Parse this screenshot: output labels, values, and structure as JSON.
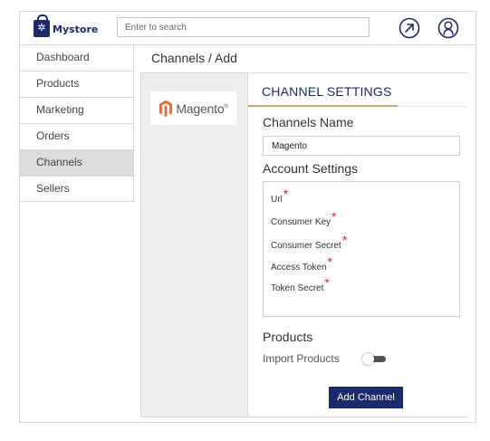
{
  "brand": {
    "name": "Mystore"
  },
  "search": {
    "placeholder": "Enter to search"
  },
  "header_icons": [
    "open-external-icon",
    "user-profile-icon"
  ],
  "sidebar": {
    "items": [
      {
        "label": "Dashboard",
        "active": false
      },
      {
        "label": "Products",
        "active": false
      },
      {
        "label": "Marketing",
        "active": false
      },
      {
        "label": "Orders",
        "active": false
      },
      {
        "label": "Channels",
        "active": true
      },
      {
        "label": "Sellers",
        "active": false
      }
    ]
  },
  "breadcrumb": "Channels / Add",
  "channel": {
    "name": "Magento"
  },
  "settings": {
    "title": "CHANNEL SETTINGS",
    "channels_name_label": "Channels Name",
    "channels_name_value": "Magento",
    "account_settings_label": "Account Settings",
    "fields": [
      "Url",
      "Consumer Key",
      "Consumer Secret",
      "Access Token",
      "Token Secret"
    ],
    "required_mark": "*",
    "products_label": "Products",
    "import_products_label": "Import Products",
    "import_products_enabled": false,
    "add_button_label": "Add Channel"
  },
  "colors": {
    "brand": "#1b2a6b",
    "magento": "#ee672f",
    "required": "#e02020",
    "accent_underline": "#c9a97a"
  }
}
